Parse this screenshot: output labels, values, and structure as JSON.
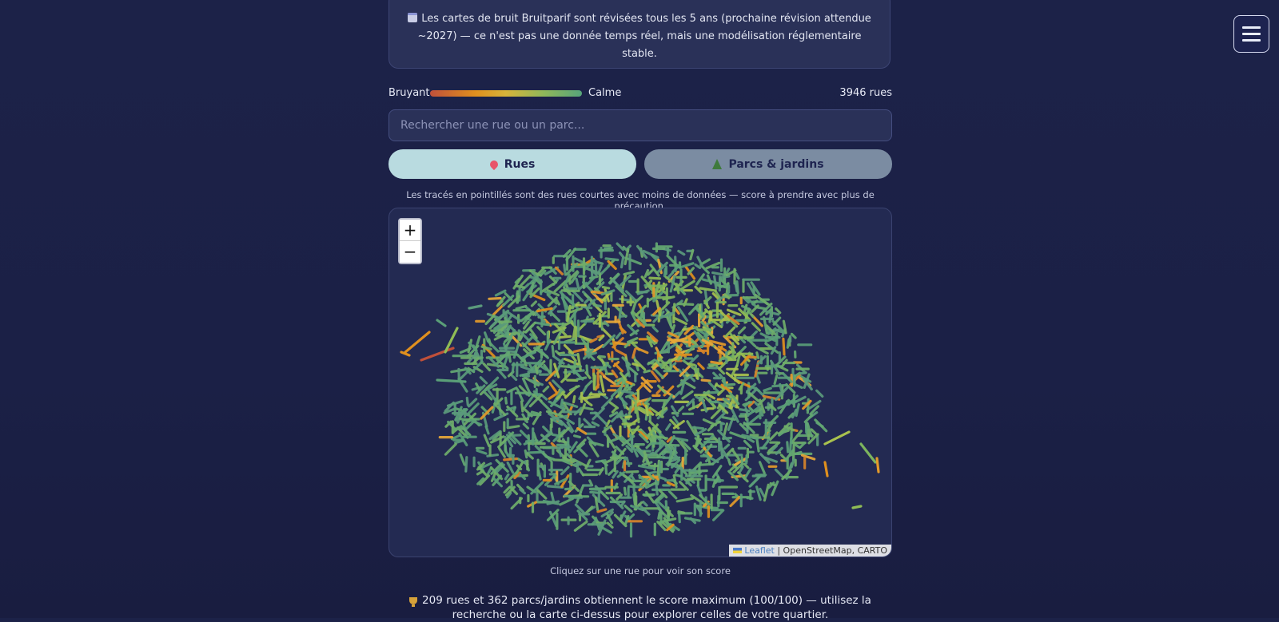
{
  "info": {
    "text": "Les cartes de bruit Bruitparif sont révisées tous les 5 ans (prochaine révision attendue ~2027) — ce n'est pas une donnée temps réel, mais une modélisation réglementaire stable.",
    "icon": "calendar-icon"
  },
  "legend": {
    "left_label": "Bruyant",
    "right_label": "Calme",
    "count": "3946 rues",
    "colors": [
      "#c0503a",
      "#e0901e",
      "#d7b43a",
      "#8fb85a",
      "#56a47a"
    ]
  },
  "search": {
    "placeholder": "Rechercher une rue ou un parc...",
    "value": ""
  },
  "tabs": [
    {
      "label": "Rues",
      "icon": "pin-icon",
      "active": true
    },
    {
      "label": "Parcs & jardins",
      "icon": "tree-icon",
      "active": false
    }
  ],
  "note": "Les tracés en pointillés sont des rues courtes avec moins de données — score à prendre avec plus de précaution.",
  "map": {
    "zoom_in": "+",
    "zoom_out": "−",
    "attribution_link": "Leaflet",
    "attribution_rest": "| OpenStreetMap, CARTO"
  },
  "hint": "Cliquez sur une rue pour voir son score",
  "summary": "209 rues et 362 parcs/jardins obtiennent le score maximum (100/100) — utilisez la recherche ou la carte ci-dessus pour explorer celles de votre quartier.",
  "menu": {
    "icon": "hamburger-icon"
  }
}
